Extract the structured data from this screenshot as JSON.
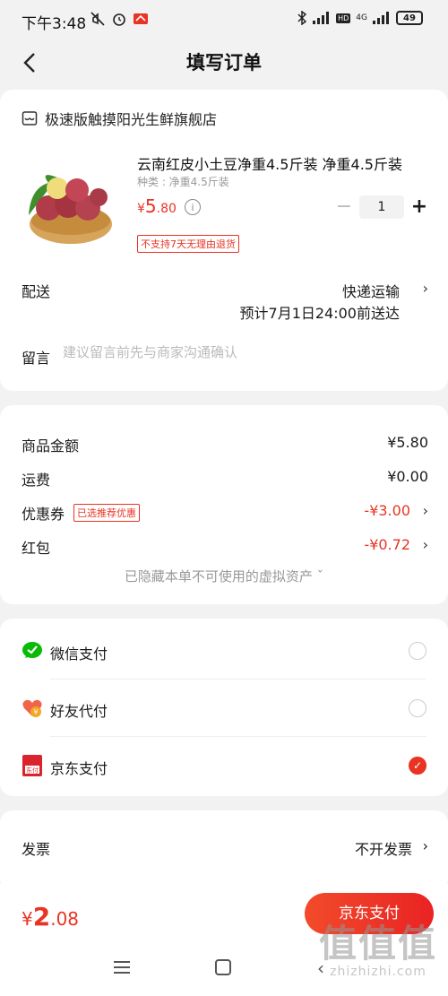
{
  "status_bar": {
    "time": "下午3:48",
    "network": "4G",
    "hd": "HD",
    "battery": "49"
  },
  "header": {
    "title": "填写订单"
  },
  "store": {
    "name": "极速版触摸阳光生鲜旗舰店"
  },
  "product": {
    "name": "云南红皮小土豆净重4.5斤装 净重4.5斤装",
    "spec": "种类 : 净重4.5斤装",
    "price_symbol": "¥",
    "price_int": "5",
    "price_dec": ".80",
    "quantity": "1",
    "minus": "−",
    "plus": "+",
    "return_tag": "不支持7天无理由退货"
  },
  "delivery": {
    "label": "配送",
    "method": "快递运输",
    "eta": "预计7月1日24:00前送达",
    "arrow": "›"
  },
  "note": {
    "label": "留言",
    "placeholder": "建议留言前先与商家沟通确认"
  },
  "amounts": {
    "goods_label": "商品金额",
    "goods_value": "¥5.80",
    "shipping_label": "运费",
    "shipping_value": "¥0.00",
    "coupon_label": "优惠券",
    "coupon_tag": "已选推荐优惠",
    "coupon_value": "-¥3.00",
    "redpacket_label": "红包",
    "redpacket_value": "-¥0.72",
    "arrow": "›",
    "hidden_assets": "已隐藏本单不可使用的虚拟资产 ˇ"
  },
  "payment": {
    "wechat": "微信支付",
    "friend": "好友代付",
    "jd": "京东支付",
    "jd_icon_text": "东付",
    "friend_icon_text": "¥",
    "selected": "jd",
    "check": "✓"
  },
  "invoice": {
    "label": "发票",
    "value": "不开发票",
    "arrow": "›"
  },
  "bottom": {
    "total_symbol": "¥",
    "total_int": "2",
    "total_dec": ".08",
    "pay_button": "京东支付"
  },
  "watermark": {
    "glyphs": "值值值",
    "url": "zhizhizhi.com"
  },
  "colors": {
    "accent": "#e93323",
    "wechat": "#09bb07"
  }
}
